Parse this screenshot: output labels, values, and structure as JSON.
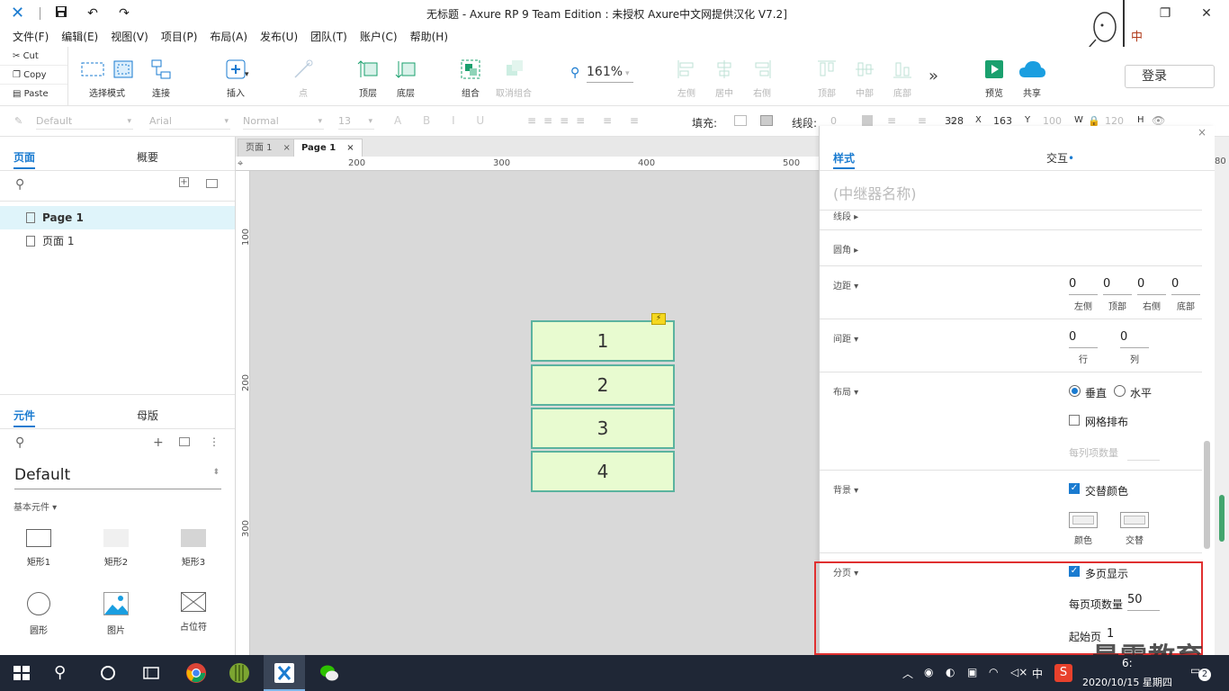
{
  "titlebar": {
    "title": "无标题 - Axure RP 9 Team Edition : 未授权     Axure中文网提供汉化 V7.2]",
    "save_icon": "save-icon",
    "undo_icon": "undo-icon",
    "redo_icon": "redo-icon"
  },
  "menu": {
    "file": "文件(F)",
    "edit": "编辑(E)",
    "view": "视图(V)",
    "project": "项目(P)",
    "layout": "布局(A)",
    "publish": "发布(U)",
    "team": "团队(T)",
    "account": "账户(C)",
    "help": "帮助(H)"
  },
  "clipboard": {
    "cut": "Cut",
    "copy": "Copy",
    "paste": "Paste"
  },
  "toolbar": {
    "select_mode": "选择模式",
    "connect": "连接",
    "insert": "插入",
    "point": "点",
    "top_layer": "顶层",
    "bottom_layer": "底层",
    "group": "组合",
    "ungroup": "取消组合",
    "zoom": "161%",
    "align_left": "左侧",
    "align_center": "居中",
    "align_right": "右侧",
    "align_top": "顶部",
    "align_middle": "中部",
    "align_bottom": "底部",
    "more": "»",
    "preview": "预览",
    "share": "共享",
    "login": "登录"
  },
  "formatbar": {
    "style": "Default",
    "font": "Arial",
    "weight": "Normal",
    "size": "13",
    "fill_label": "填充:",
    "stroke_label": "线段:",
    "stroke_value": "0",
    "x": "328",
    "x_label": "X",
    "y": "163",
    "y_label": "Y",
    "w": "100",
    "w_label": "W",
    "h": "120",
    "h_label": "H"
  },
  "pages_panel": {
    "tab_pages": "页面",
    "tab_outline": "概要",
    "pages": [
      "Page 1",
      "页面 1"
    ]
  },
  "widgets_panel": {
    "tab_widgets": "元件",
    "tab_masters": "母版",
    "library": "Default",
    "category": "基本元件",
    "widgets": [
      "矩形1",
      "矩形2",
      "矩形3",
      "圆形",
      "图片",
      "占位符"
    ]
  },
  "doc_tabs": [
    "页面 1",
    "Page 1"
  ],
  "ruler": {
    "h": [
      "200",
      "300",
      "400",
      "500"
    ],
    "v": [
      "100",
      "200",
      "300"
    ],
    "h_right": "80"
  },
  "repeater": {
    "items": [
      "1",
      "2",
      "3",
      "4"
    ],
    "bolt": "⚡"
  },
  "inspector": {
    "tab_style": "样式",
    "tab_interaction": "交互",
    "name_placeholder": "(中继器名称)",
    "stroke": "线段",
    "corner": "圆角",
    "padding": "边距",
    "padding_values": [
      "0",
      "0",
      "0",
      "0"
    ],
    "padding_labels": [
      "左侧",
      "顶部",
      "右侧",
      "底部"
    ],
    "spacing": "间距",
    "spacing_values": [
      "0",
      "0"
    ],
    "spacing_labels": [
      "行",
      "列"
    ],
    "layout": "布局",
    "vertical": "垂直",
    "horizontal": "水平",
    "grid": "网格排布",
    "items_per_column": "每列项数量",
    "background": "背景",
    "alternate_color": "交替颜色",
    "color": "颜色",
    "alternate": "交替",
    "pagination": "分页",
    "multi_page": "多页显示",
    "items_per_page_label": "每页项数量",
    "items_per_page": "50",
    "start_page_label": "起始页",
    "start_page": "1"
  },
  "watermark": "最需教育",
  "taskbar": {
    "time": "6:",
    "date": "2020/10/15 星期四",
    "ime": "中",
    "notif": "2"
  },
  "colors": {
    "accent": "#1a7bd0",
    "repeater_fill": "#e8fbd0",
    "repeater_border": "#5bb39f",
    "highlight": "#e03030"
  }
}
